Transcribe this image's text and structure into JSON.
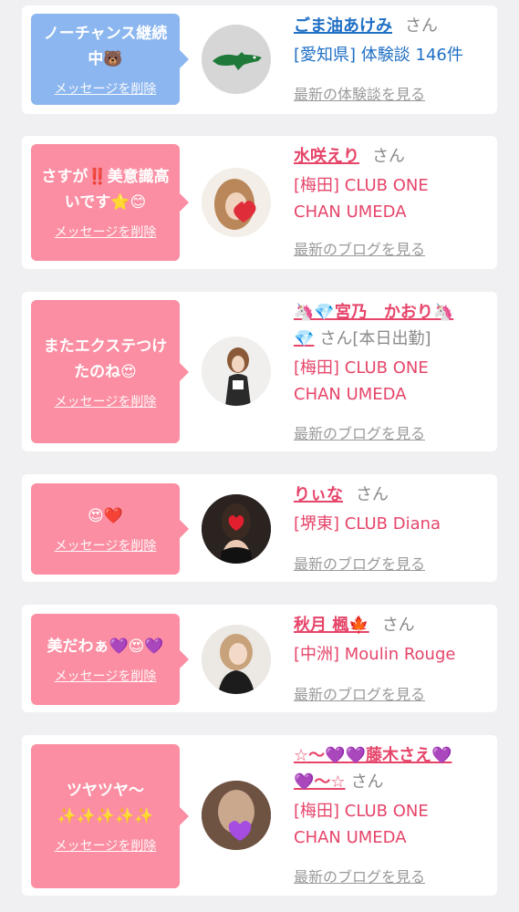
{
  "delete_label": "メッセージを削除",
  "colors": {
    "blue_bubble": "#8cb6ef",
    "pink_bubble": "#fb8ea2",
    "blue_text": "#1f6fc4",
    "pink_text": "#e6456a"
  },
  "cards": [
    {
      "theme": "blue",
      "message": "ノーチャンス継続\n中🐻",
      "name": "ごま油あけみ",
      "san": "さん",
      "location": "[愛知県] 体験談 146件",
      "more": "最新の体験談を見る"
    },
    {
      "theme": "pink",
      "message": "さすが‼️美意識高\nいです⭐😊",
      "name": "水咲えり",
      "san": "さん",
      "location": "[梅田] CLUB ONE\nCHAN UMEDA",
      "more": "最新のブログを見る"
    },
    {
      "theme": "pink",
      "message": "またエクステつけ\nたのね😍",
      "name": "🦄💎宮乃　かおり🦄\n💎",
      "san": "さん[本日出勤]",
      "location": "[梅田] CLUB ONE\nCHAN UMEDA",
      "more": "最新のブログを見る"
    },
    {
      "theme": "pink",
      "message": "😍❤️",
      "name": "りぃな",
      "san": "さん",
      "location": "[堺東] CLUB Diana",
      "more": "最新のブログを見る"
    },
    {
      "theme": "pink",
      "message": "美だわぁ💜😍💜",
      "name": "秋月 楓🍁",
      "san": "さん",
      "location": "[中洲] Moulin Rouge",
      "more": "最新のブログを見る"
    },
    {
      "theme": "pink",
      "message": "ツヤツヤ〜\n✨✨✨✨✨",
      "name": "☆〜💜💜藤木さえ💜\n💜〜☆",
      "san": "さん",
      "location": "[梅田] CLUB ONE\nCHAN UMEDA",
      "more": "最新のブログを見る"
    }
  ]
}
